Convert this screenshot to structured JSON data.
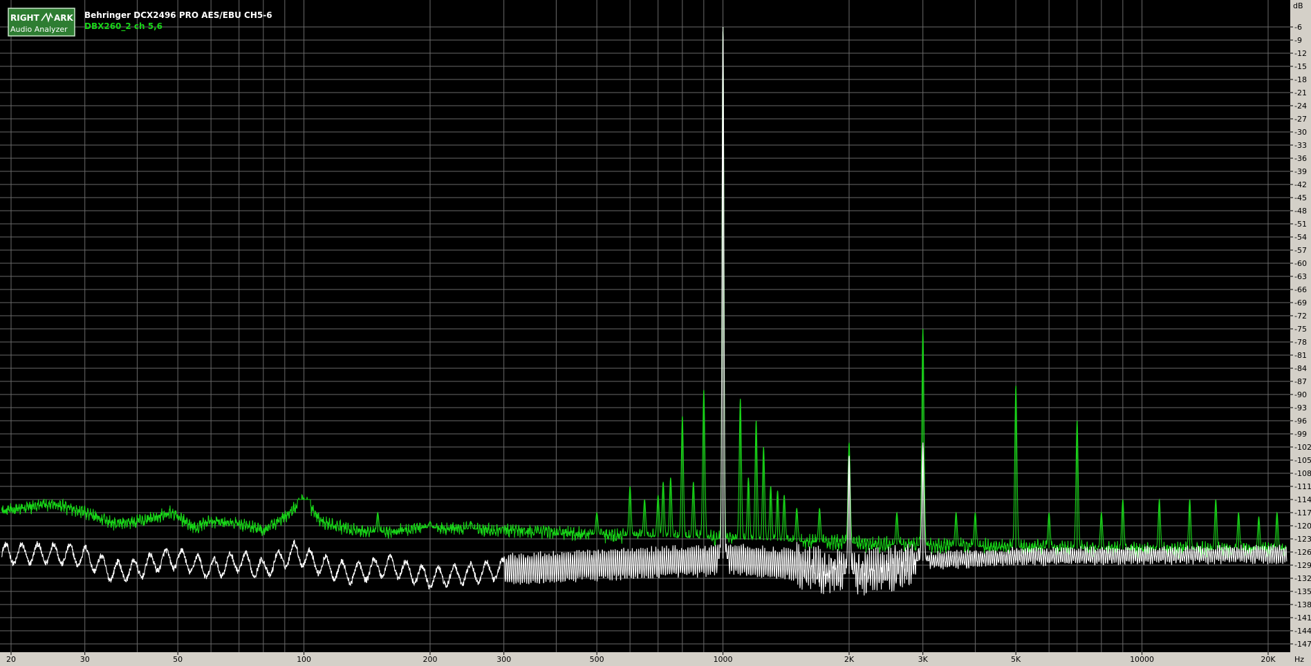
{
  "logo": {
    "line1_left": "RIGHT",
    "line1_right": "ARK",
    "line2": "Audio Analyzer"
  },
  "header": {
    "title": "Behringer DCX2496 PRO AES/EBU CH5-6",
    "subtitle": "DBX260_2 ch 5,6"
  },
  "colors": {
    "background": "#000000",
    "grid": "#6a6a6a",
    "axis_panel": "#d4d0c8",
    "series_white": "#ffffff",
    "series_green": "#18d418",
    "logo_green": "#2e7d32"
  },
  "chart_data": {
    "type": "line",
    "title": "Behringer DCX2496 PRO AES/EBU CH5-6",
    "xlabel": "Hz",
    "ylabel": "dB",
    "xscale": "log",
    "xlim": [
      20,
      22000
    ],
    "ylim": [
      -149,
      -3
    ],
    "grid": true,
    "x_ticks": [
      20,
      30,
      50,
      100,
      200,
      300,
      500,
      1000,
      2000,
      3000,
      5000,
      10000,
      20000
    ],
    "x_tick_labels": [
      "20",
      "30",
      "50",
      "100",
      "200",
      "300",
      "500",
      "1000",
      "2K",
      "3K",
      "5K",
      "10000",
      "20K"
    ],
    "y_ticks": [
      -6,
      -9,
      -12,
      -15,
      -18,
      -21,
      -24,
      -27,
      -30,
      -33,
      -36,
      -39,
      -42,
      -45,
      -48,
      -51,
      -54,
      -57,
      -60,
      -63,
      -66,
      -69,
      -72,
      -75,
      -78,
      -81,
      -84,
      -87,
      -90,
      -93,
      -96,
      -99,
      -102,
      -105,
      -108,
      -111,
      -114,
      -117,
      -120,
      -123,
      -126,
      -129,
      -132,
      -135,
      -138,
      -141,
      -144,
      -147
    ],
    "series": [
      {
        "name": "Behringer DCX2496 PRO AES/EBU CH5-6",
        "color": "#ffffff",
        "baseline": [
          [
            20,
            -126.5
          ],
          [
            25,
            -126.3
          ],
          [
            30,
            -127
          ],
          [
            35,
            -130.5
          ],
          [
            40,
            -130
          ],
          [
            45,
            -128
          ],
          [
            50,
            -127.5
          ],
          [
            60,
            -130
          ],
          [
            70,
            -128
          ],
          [
            80,
            -130
          ],
          [
            95,
            -126
          ],
          [
            110,
            -129
          ],
          [
            130,
            -131
          ],
          [
            160,
            -129
          ],
          [
            200,
            -132
          ],
          [
            300,
            -130
          ],
          [
            500,
            -129
          ],
          [
            900,
            -128
          ],
          [
            1000,
            -127.5
          ],
          [
            1500,
            -129
          ],
          [
            2000,
            -131
          ],
          [
            2500,
            -130
          ],
          [
            3000,
            -128
          ],
          [
            4000,
            -127.5
          ],
          [
            5000,
            -127
          ],
          [
            10000,
            -126.8
          ],
          [
            22000,
            -126.5
          ]
        ],
        "peaks": [
          [
            1000,
            -6
          ],
          [
            2000,
            -104
          ],
          [
            3000,
            -101
          ]
        ]
      },
      {
        "name": "DBX260_2 ch 5,6",
        "color": "#18d418",
        "baseline": [
          [
            20,
            -116.5
          ],
          [
            25,
            -115
          ],
          [
            30,
            -117
          ],
          [
            35,
            -119.5
          ],
          [
            40,
            -119
          ],
          [
            45,
            -118
          ],
          [
            48,
            -117
          ],
          [
            55,
            -120.5
          ],
          [
            60,
            -119
          ],
          [
            70,
            -119.5
          ],
          [
            80,
            -121
          ],
          [
            90,
            -118
          ],
          [
            100,
            -114
          ],
          [
            110,
            -119
          ],
          [
            130,
            -121
          ],
          [
            150,
            -121.5
          ],
          [
            200,
            -120.5
          ],
          [
            300,
            -121
          ],
          [
            500,
            -122
          ],
          [
            700,
            -122.5
          ],
          [
            1000,
            -123
          ],
          [
            2000,
            -124
          ],
          [
            3000,
            -124.5
          ],
          [
            5000,
            -125
          ],
          [
            10000,
            -125.5
          ],
          [
            22000,
            -125.5
          ]
        ],
        "peaks": [
          [
            100,
            -114
          ],
          [
            150,
            -117
          ],
          [
            200,
            -119
          ],
          [
            250,
            -119
          ],
          [
            500,
            -117
          ],
          [
            600,
            -111
          ],
          [
            650,
            -114
          ],
          [
            700,
            -113
          ],
          [
            720,
            -110
          ],
          [
            750,
            -109
          ],
          [
            800,
            -95
          ],
          [
            850,
            -110
          ],
          [
            900,
            -89
          ],
          [
            1000,
            -6
          ],
          [
            1100,
            -91
          ],
          [
            1150,
            -109
          ],
          [
            1200,
            -96
          ],
          [
            1250,
            -102
          ],
          [
            1300,
            -111
          ],
          [
            1350,
            -112
          ],
          [
            1400,
            -113
          ],
          [
            1500,
            -116
          ],
          [
            1700,
            -116
          ],
          [
            2000,
            -101
          ],
          [
            2600,
            -117
          ],
          [
            3000,
            -75
          ],
          [
            3600,
            -117
          ],
          [
            4000,
            -117
          ],
          [
            5000,
            -88
          ],
          [
            6000,
            -117
          ],
          [
            7000,
            -96
          ],
          [
            8000,
            -117
          ],
          [
            9000,
            -114
          ],
          [
            11000,
            -114
          ],
          [
            13000,
            -114
          ],
          [
            15000,
            -114
          ],
          [
            17000,
            -117
          ],
          [
            19000,
            -118
          ],
          [
            21000,
            -117
          ]
        ]
      }
    ]
  }
}
